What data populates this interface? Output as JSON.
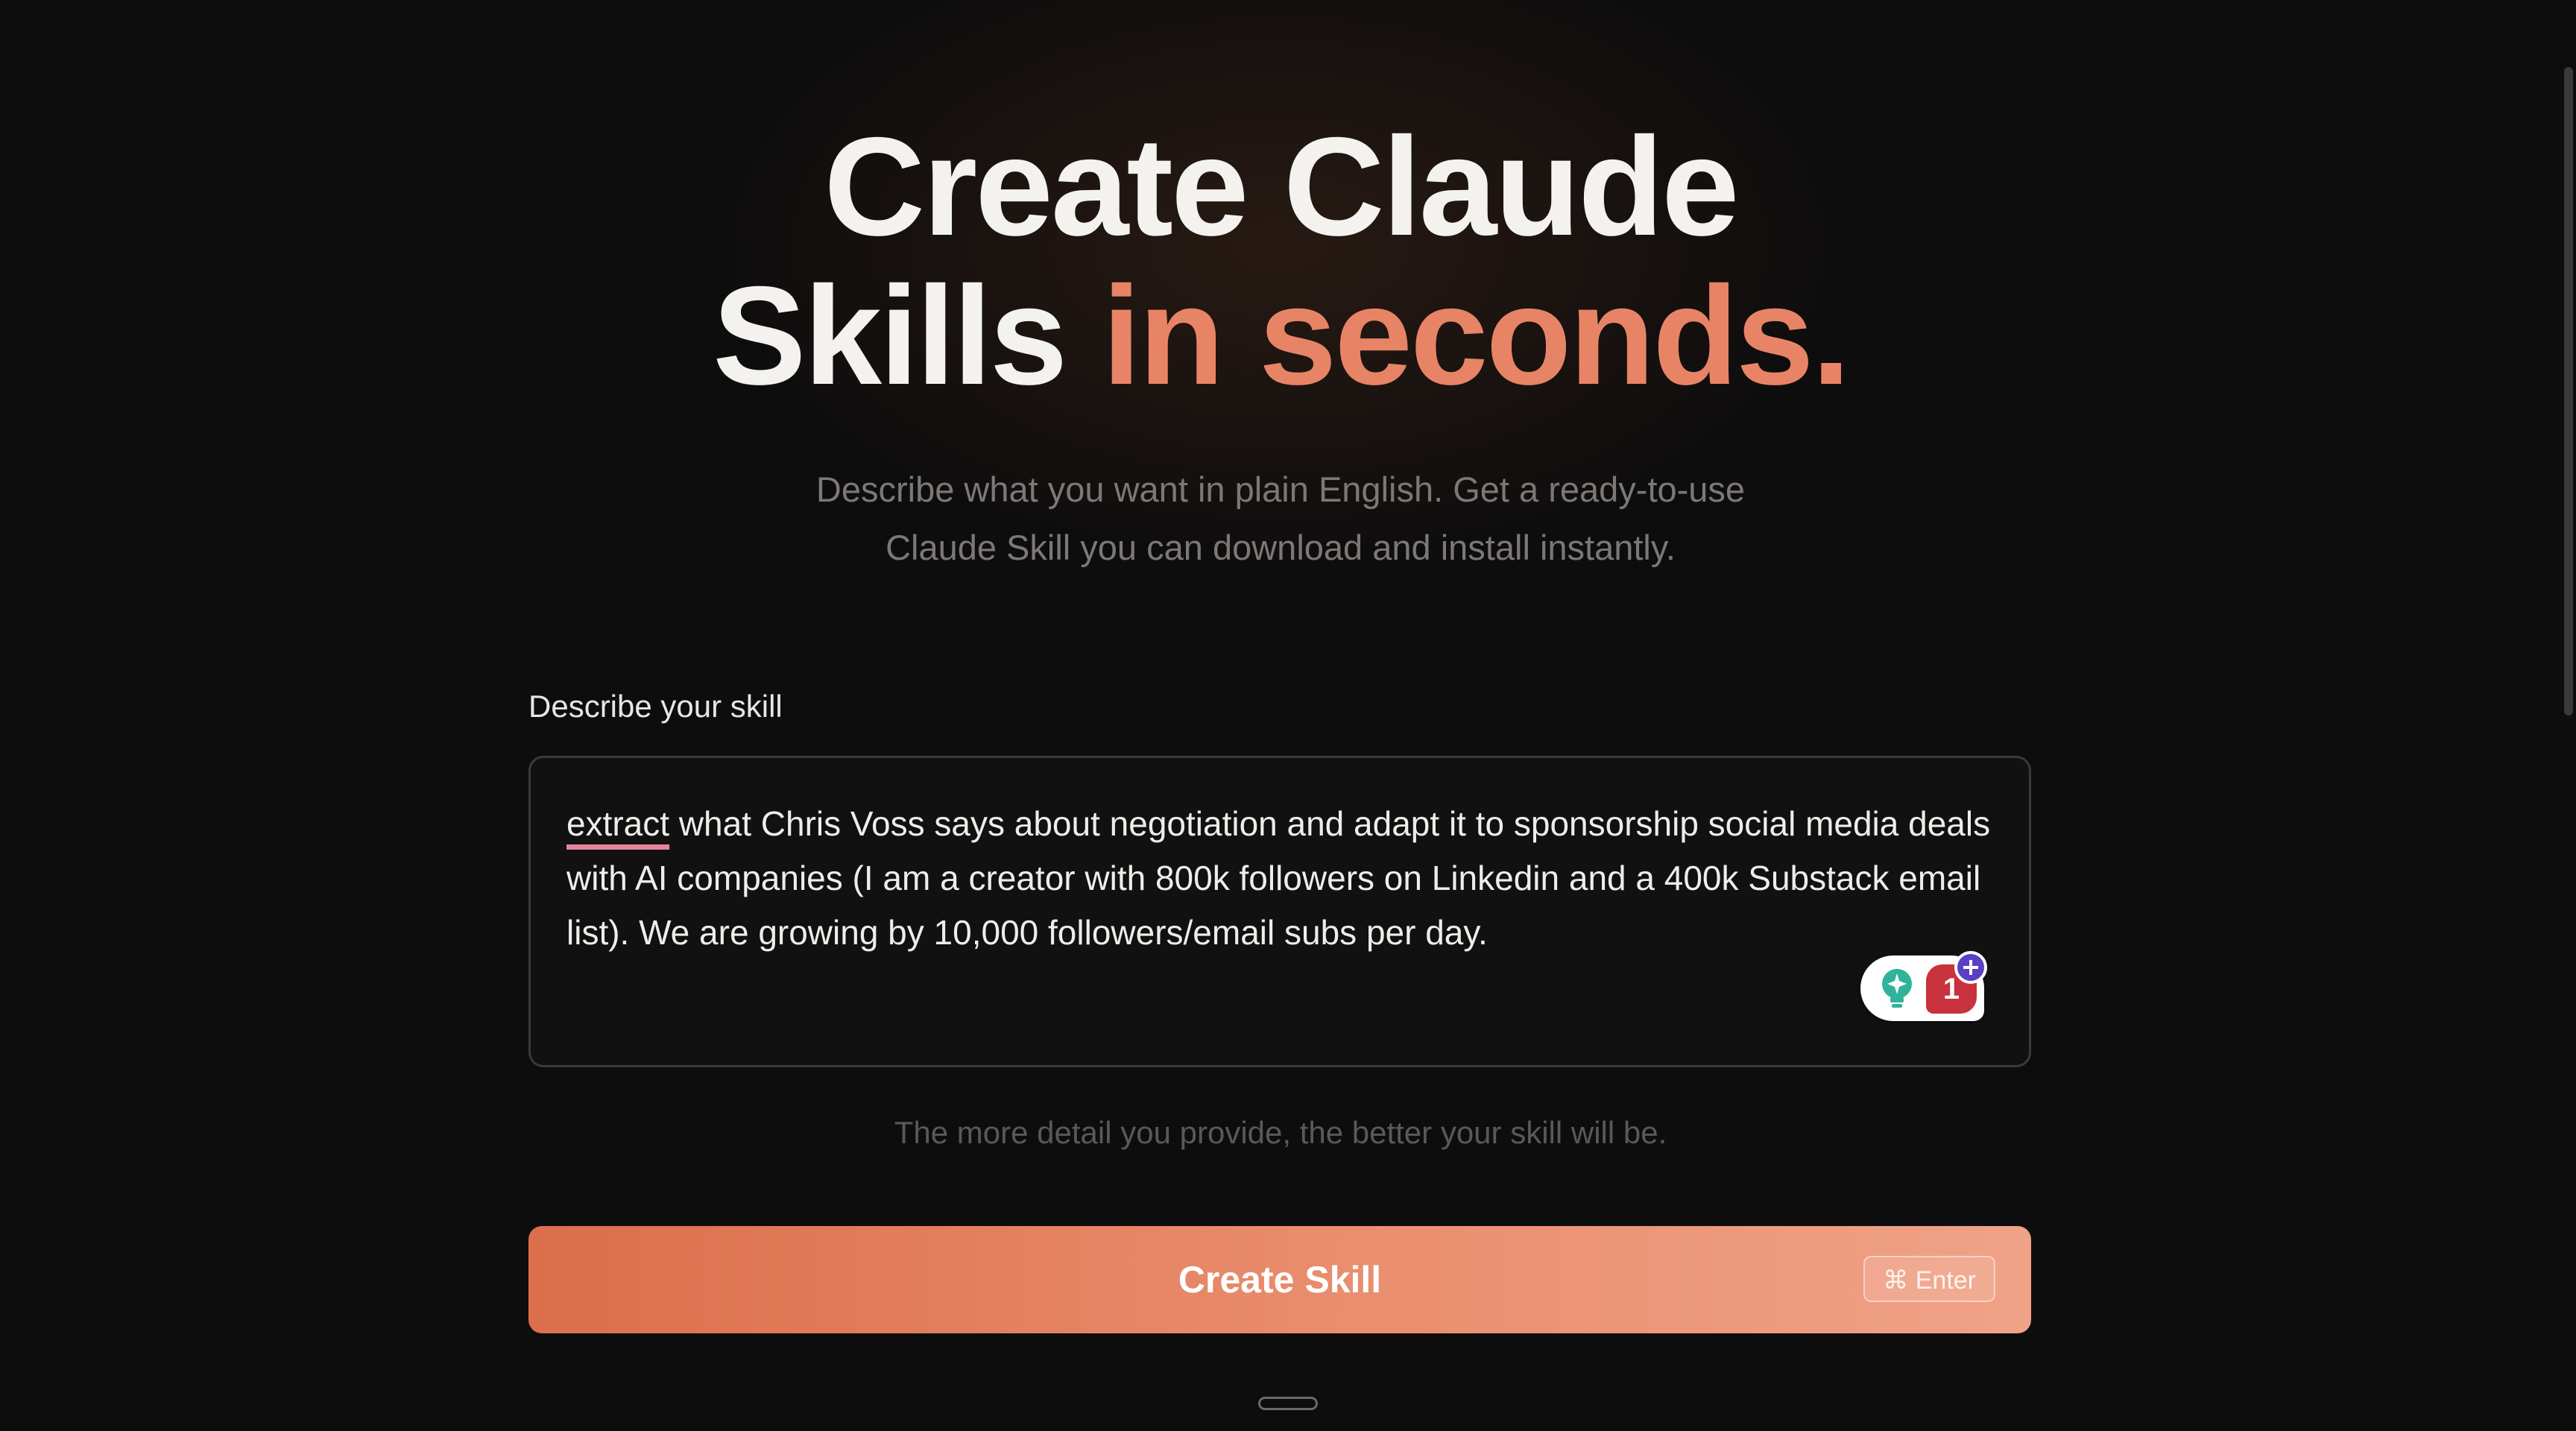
{
  "hero": {
    "title_line1": "Create Claude",
    "title_line2_plain": "Skills ",
    "title_line2_accent": "in seconds.",
    "subtitle_line1": "Describe what you want in plain English. Get a ready-to-use",
    "subtitle_line2": "Claude Skill you can download and install instantly."
  },
  "form": {
    "label": "Describe your skill",
    "value_misspelled_word": "extract",
    "value_rest": " what Chris Voss says about negotiation and adapt it to sponsorship social media deals with AI companies (I am a creator with 800k followers on Linkedin and a 400k Substack email list). We are growing by 10,000 followers/email subs per day.",
    "hint": "The more detail you provide, the better your skill will be.",
    "grammar_widget": {
      "suggestion_count": "1",
      "icons": [
        "lightbulb-icon",
        "plus-icon"
      ]
    }
  },
  "button": {
    "label": "Create Skill",
    "shortcut": "⌘ Enter"
  },
  "colors": {
    "background": "#0e0d0d",
    "title": "#f4f2ef",
    "accent": "#e88466",
    "button_gradient_start": "#dc6e4c",
    "button_gradient_end": "#f0a287",
    "spellcheck_underline": "#e7839b"
  }
}
